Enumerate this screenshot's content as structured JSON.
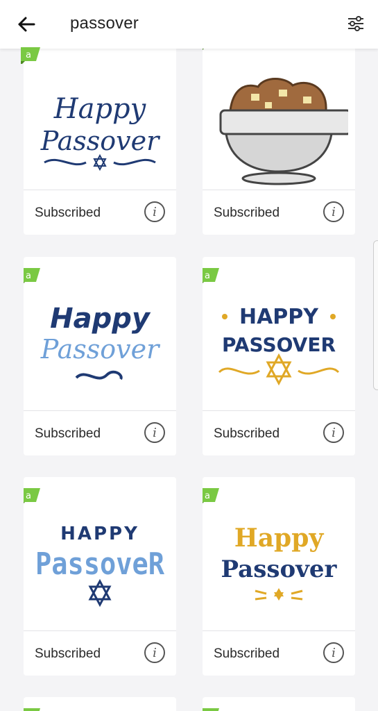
{
  "header": {
    "search_query": "passover"
  },
  "icons": {
    "back": "arrow-left-icon",
    "filter": "sliders-icon",
    "badge": "access-badge-icon",
    "info": "info-icon"
  },
  "colors": {
    "accent_green": "#7ac943",
    "navy": "#1f3a73",
    "light_blue": "#6fa0d8",
    "gold": "#e0a826"
  },
  "cards": [
    {
      "status": "Subscribed",
      "info_glyph": "i",
      "art_text": [
        "Happy",
        "Passover"
      ]
    },
    {
      "status": "Subscribed",
      "info_glyph": "i",
      "art_text": []
    },
    {
      "status": "Subscribed",
      "info_glyph": "i",
      "art_text": [
        "Happy",
        "Passover"
      ]
    },
    {
      "status": "Subscribed",
      "info_glyph": "i",
      "art_text": [
        "HAPPY",
        "PASSOVER"
      ]
    },
    {
      "status": "Subscribed",
      "info_glyph": "i",
      "art_text": [
        "HAPPY",
        "PassoveR"
      ]
    },
    {
      "status": "Subscribed",
      "info_glyph": "i",
      "art_text": [
        "Happy",
        "Passover"
      ]
    }
  ]
}
